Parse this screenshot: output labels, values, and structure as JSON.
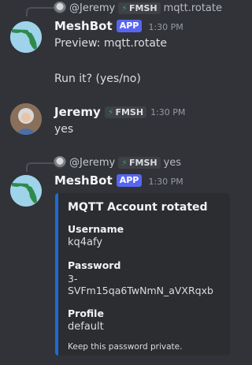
{
  "reply1": {
    "author": "@Jeremy",
    "tag": "FMSH",
    "text": "mqtt.rotate"
  },
  "msg1": {
    "author": "MeshBot",
    "badge": "APP",
    "time": "1:30 PM",
    "line1": "Preview: mqtt.rotate",
    "line2": "Run it? (yes/no)"
  },
  "msg2": {
    "author": "Jeremy",
    "tag": "FMSH",
    "time": "1:30 PM",
    "text": "yes"
  },
  "reply2": {
    "author": "@Jeremy",
    "tag": "FMSH",
    "text": "yes"
  },
  "msg3": {
    "author": "MeshBot",
    "badge": "APP",
    "time": "1:30 PM"
  },
  "embed": {
    "title": "MQTT Account rotated",
    "fields": [
      {
        "name": "Username",
        "value": "kq4afy"
      },
      {
        "name": "Password",
        "value": "3-SVFm15qa6TwNmN_aVXRqxb"
      },
      {
        "name": "Profile",
        "value": "default"
      }
    ],
    "footer": "Keep this password private.",
    "accent_color": "#1e6bd6"
  },
  "icons": {
    "bolt": "⚡"
  }
}
